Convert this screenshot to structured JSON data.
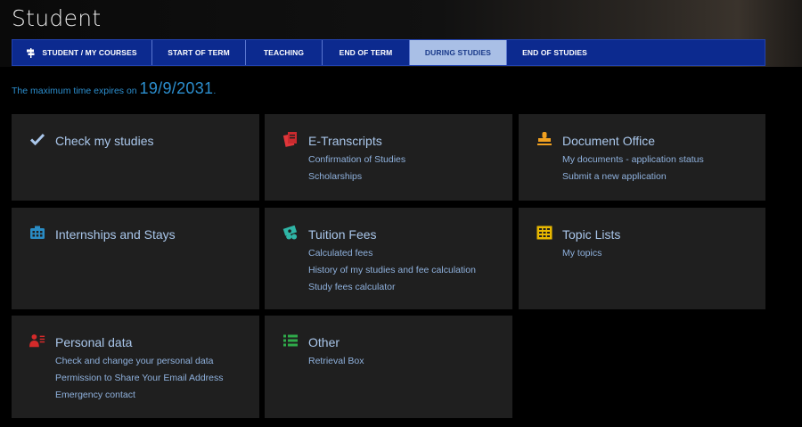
{
  "page": {
    "title": "Student"
  },
  "tabs": [
    {
      "label": "Student / My Courses",
      "active": false
    },
    {
      "label": "Start of Term",
      "active": false
    },
    {
      "label": "Teaching",
      "active": false
    },
    {
      "label": "End of Term",
      "active": false
    },
    {
      "label": "During Studies",
      "active": true
    },
    {
      "label": "End of Studies",
      "active": false
    }
  ],
  "notice": {
    "prefix": "The maximum time expires on ",
    "date": "19/9/2031",
    "suffix": "."
  },
  "cards": {
    "check_studies": {
      "title": "Check my studies",
      "icon": "checkmark-icon",
      "links": []
    },
    "e_transcripts": {
      "title": "E-Transcripts",
      "icon": "documents-icon",
      "links": [
        "Confirmation of Studies",
        "Scholarships"
      ]
    },
    "document_office": {
      "title": "Document Office",
      "icon": "stamp-icon",
      "links": [
        "My documents - application status",
        "Submit a new application"
      ]
    },
    "internships": {
      "title": "Internships and Stays",
      "icon": "building-icon",
      "links": []
    },
    "tuition_fees": {
      "title": "Tuition Fees",
      "icon": "money-icon",
      "links": [
        "Calculated fees",
        "History of my studies and fee calculation",
        "Study fees calculator"
      ]
    },
    "topic_lists": {
      "title": "Topic Lists",
      "icon": "grid-list-icon",
      "links": [
        "My topics"
      ]
    },
    "personal_data": {
      "title": "Personal data",
      "icon": "person-card-icon",
      "links": [
        "Check and change your personal data",
        "Permission to Share Your Email Address",
        "Emergency contact"
      ]
    },
    "other": {
      "title": "Other",
      "icon": "list-icon",
      "links": [
        "Retrieval Box"
      ]
    }
  },
  "colors": {
    "tabbar": "#0c2a8f",
    "tab_active": "#a9bfe6",
    "card_bg": "#1f1f1f",
    "card_title": "#a9c6ea",
    "card_link": "#8fb1dd",
    "notice": "#2c8fcf"
  }
}
